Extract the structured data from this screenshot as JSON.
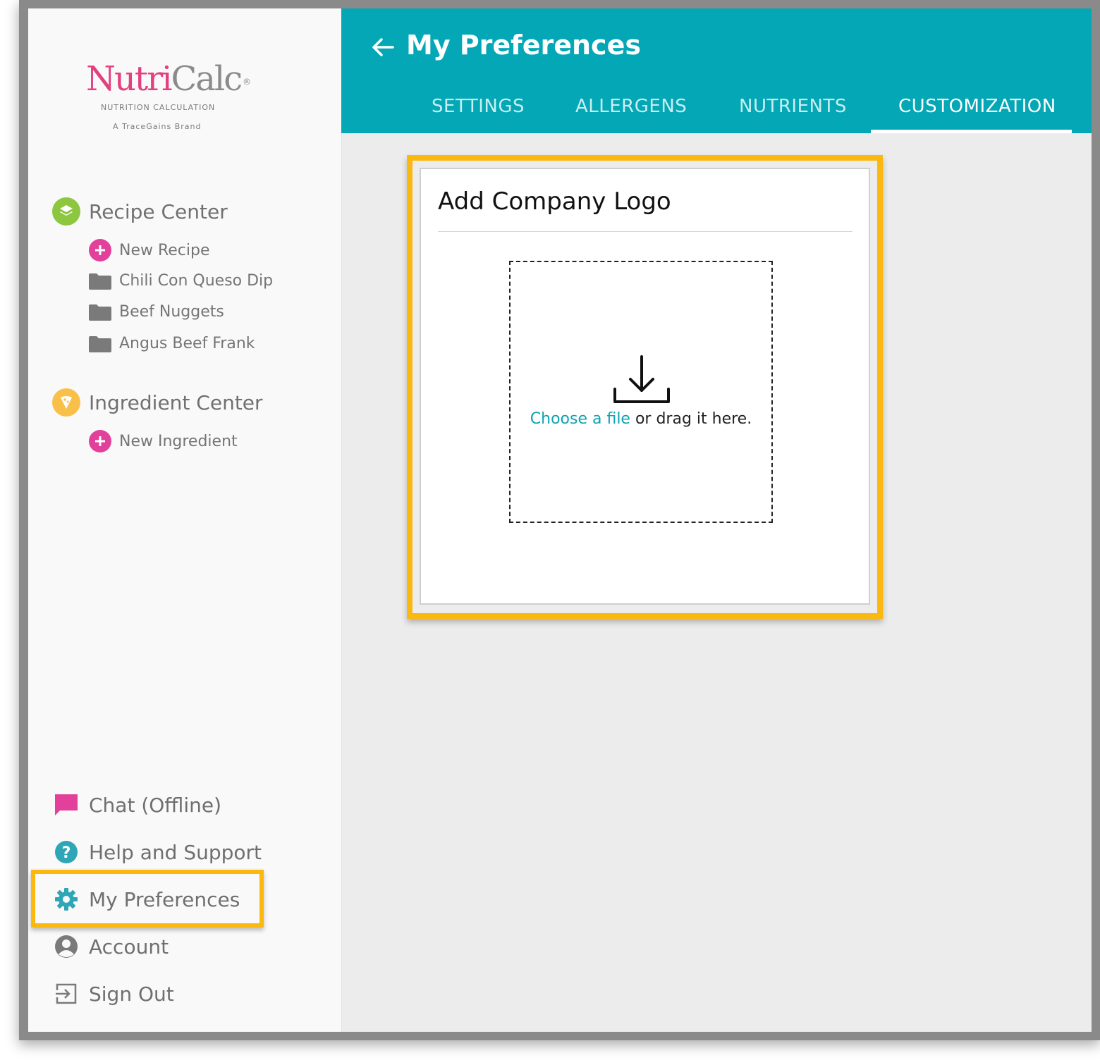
{
  "logo": {
    "brand_part1": "Nutri",
    "brand_part2": "Calc",
    "registered": "®",
    "tagline": "NUTRITION CALCULATION",
    "subbrand": "A TraceGains Brand"
  },
  "sidebar": {
    "recipe_center": {
      "label": "Recipe Center",
      "items": [
        {
          "label": "New Recipe",
          "icon": "plus-icon"
        },
        {
          "label": "Chili Con Queso Dip",
          "icon": "folder-icon"
        },
        {
          "label": "Beef Nuggets",
          "icon": "folder-icon"
        },
        {
          "label": "Angus Beef Frank",
          "icon": "folder-icon"
        }
      ]
    },
    "ingredient_center": {
      "label": "Ingredient Center",
      "items": [
        {
          "label": "New Ingredient",
          "icon": "plus-icon"
        }
      ]
    },
    "bottom": [
      {
        "label": "Chat (Offline)",
        "icon": "chat-icon"
      },
      {
        "label": "Help and Support",
        "icon": "help-icon"
      },
      {
        "label": "My Preferences",
        "icon": "gear-icon"
      },
      {
        "label": "Account",
        "icon": "account-icon"
      },
      {
        "label": "Sign Out",
        "icon": "sign-out-icon"
      }
    ]
  },
  "header": {
    "title": "My Preferences",
    "tabs": [
      {
        "label": "SETTINGS",
        "active": false
      },
      {
        "label": "ALLERGENS",
        "active": false
      },
      {
        "label": "NUTRIENTS",
        "active": false
      },
      {
        "label": "CUSTOMIZATION",
        "active": true
      }
    ]
  },
  "card": {
    "title": "Add Company Logo",
    "choose_link": "Choose a file",
    "drop_text": " or drag it here."
  },
  "colors": {
    "header_bg": "#03a7b5",
    "highlight": "#fbb80f",
    "brand_pink": "#e2407f",
    "link": "#0ea3b3"
  }
}
